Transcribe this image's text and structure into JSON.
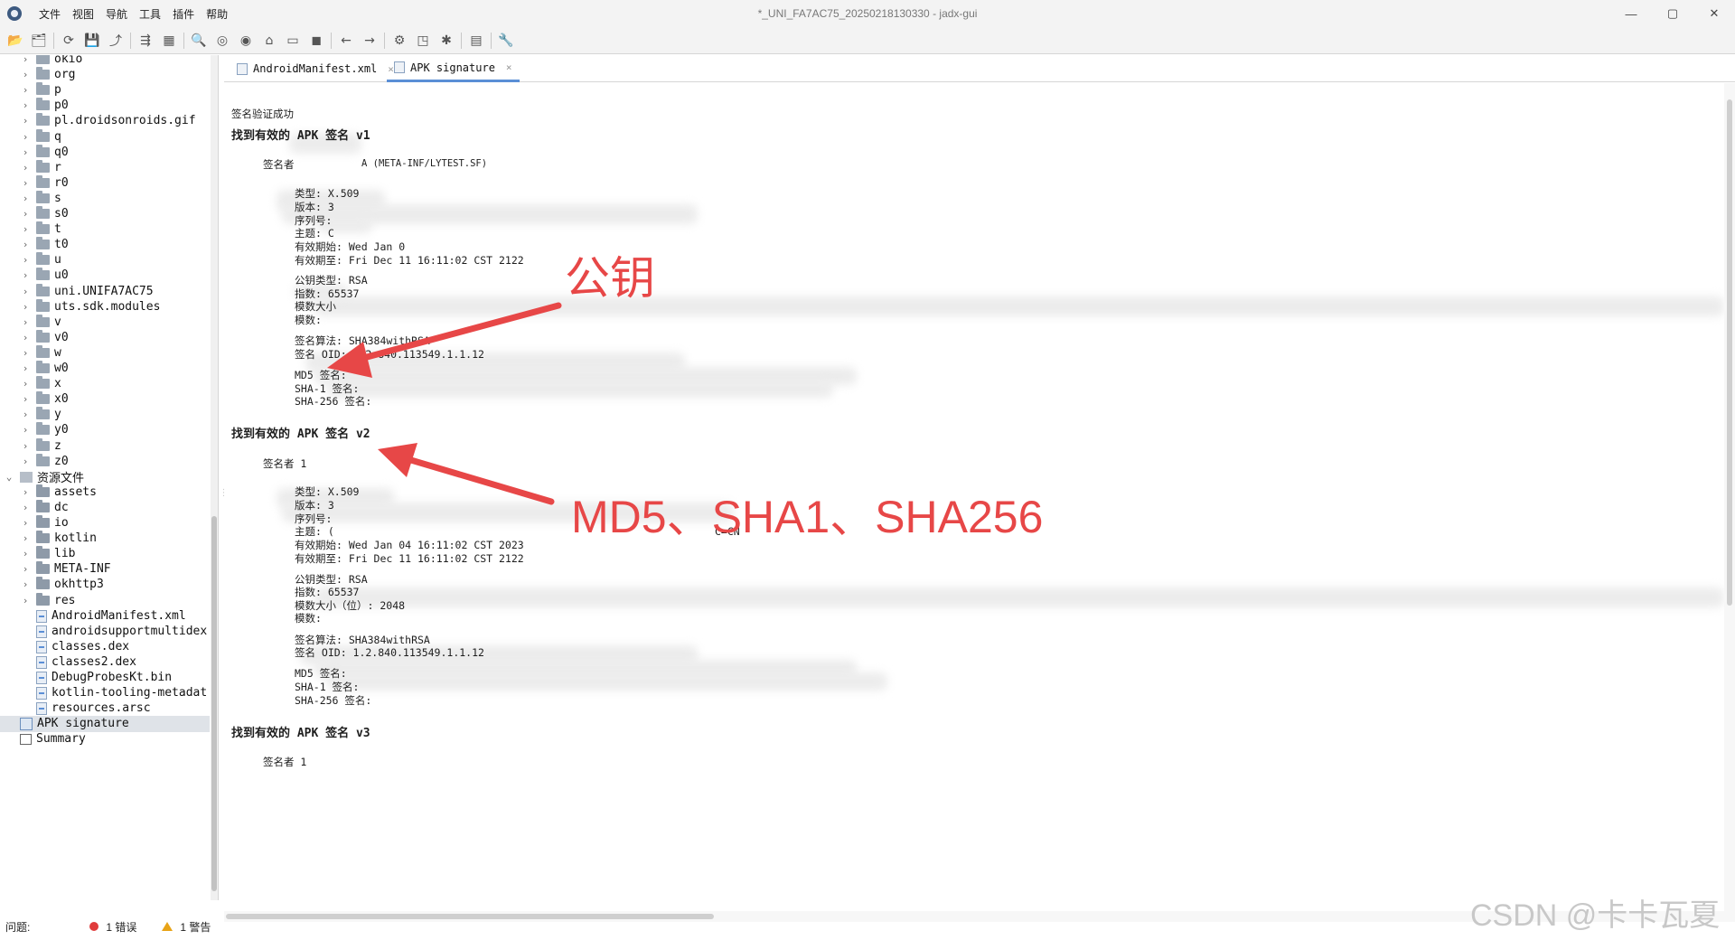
{
  "window": {
    "title": "*_UNI_FA7AC75_20250218130330 - jadx-gui",
    "controls": [
      "—",
      "▢",
      "✕"
    ]
  },
  "menu": [
    "文件",
    "视图",
    "导航",
    "工具",
    "插件",
    "帮助"
  ],
  "toolbar_icons": [
    "open-file-icon",
    "add-files-icon",
    "sync-icon",
    "save-icon",
    "export-icon",
    "flatten-icon",
    "deobf-icon",
    "search-icon",
    "find-class-icon",
    "find-usage-icon",
    "home-icon",
    "log-icon",
    "mark-icon",
    "back-icon",
    "forward-icon",
    "quark-icon",
    "frida-icon",
    "debug-icon",
    "log-viewer-icon",
    "settings-icon"
  ],
  "tree": {
    "items": [
      {
        "label": "okio",
        "icon": "package"
      },
      {
        "label": "org",
        "icon": "package"
      },
      {
        "label": "p",
        "icon": "package"
      },
      {
        "label": "p0",
        "icon": "package"
      },
      {
        "label": "pl.droidsonroids.gif",
        "icon": "package"
      },
      {
        "label": "q",
        "icon": "package"
      },
      {
        "label": "q0",
        "icon": "package"
      },
      {
        "label": "r",
        "icon": "package"
      },
      {
        "label": "r0",
        "icon": "package"
      },
      {
        "label": "s",
        "icon": "package"
      },
      {
        "label": "s0",
        "icon": "package"
      },
      {
        "label": "t",
        "icon": "package"
      },
      {
        "label": "t0",
        "icon": "package"
      },
      {
        "label": "u",
        "icon": "package"
      },
      {
        "label": "u0",
        "icon": "package"
      },
      {
        "label": "uni.UNIFA7AC75",
        "icon": "package"
      },
      {
        "label": "uts.sdk.modules",
        "icon": "package"
      },
      {
        "label": "v",
        "icon": "package"
      },
      {
        "label": "v0",
        "icon": "package"
      },
      {
        "label": "w",
        "icon": "package"
      },
      {
        "label": "w0",
        "icon": "package"
      },
      {
        "label": "x",
        "icon": "package"
      },
      {
        "label": "x0",
        "icon": "package"
      },
      {
        "label": "y",
        "icon": "package"
      },
      {
        "label": "y0",
        "icon": "package"
      },
      {
        "label": "z",
        "icon": "package"
      },
      {
        "label": "z0",
        "icon": "package"
      },
      {
        "label": "资源文件",
        "icon": "resources"
      },
      {
        "label": "assets",
        "icon": "folder"
      },
      {
        "label": "dc",
        "icon": "folder"
      },
      {
        "label": "io",
        "icon": "folder"
      },
      {
        "label": "kotlin",
        "icon": "folder"
      },
      {
        "label": "lib",
        "icon": "folder"
      },
      {
        "label": "META-INF",
        "icon": "folder"
      },
      {
        "label": "okhttp3",
        "icon": "folder"
      },
      {
        "label": "res",
        "icon": "folder"
      },
      {
        "label": "AndroidManifest.xml",
        "icon": "file"
      },
      {
        "label": "androidsupportmultidex",
        "icon": "file"
      },
      {
        "label": "classes.dex",
        "icon": "file"
      },
      {
        "label": "classes2.dex",
        "icon": "file"
      },
      {
        "label": "DebugProbesKt.bin",
        "icon": "file"
      },
      {
        "label": "kotlin-tooling-metadat",
        "icon": "file"
      },
      {
        "label": "resources.arsc",
        "icon": "file"
      },
      {
        "label": "APK signature",
        "icon": "signature"
      },
      {
        "label": "Summary",
        "icon": "summary"
      }
    ]
  },
  "status": {
    "label": "问题:",
    "errors": "1 错误",
    "warnings": "1 警告"
  },
  "tabs": [
    {
      "label": "AndroidManifest.xml",
      "close": "×"
    },
    {
      "label": "APK signature",
      "close": "×"
    }
  ],
  "signature": {
    "status": "签名验证成功",
    "v1": {
      "heading": "找到有效的 APK 签名 v1",
      "signer": "签名者",
      "signer_suffix": "A (META-INF/LYTEST.SF)",
      "type": "类型: X.509",
      "version": "版本: 3",
      "serial": "序列号:",
      "subject": "主题: C",
      "valid_from": "有效期始: Wed Jan 0",
      "valid_to": "有效期至: Fri Dec 11 16:11:02 CST 2122",
      "pubkey_type": "公钥类型: RSA",
      "exponent": "指数: 65537",
      "modulus_size": "模数大小",
      "modulus": "模数:",
      "sig_alg": "签名算法: SHA384withRSA",
      "sig_oid": "签名 OID: 1.2.840.113549.1.1.12",
      "md5": "MD5 签名:",
      "sha1": "SHA-1 签名:",
      "sha256": "SHA-256 签名:"
    },
    "v2": {
      "heading": "找到有效的 APK 签名 v2",
      "signer": "签名者 1",
      "type": "类型: X.509",
      "version": "版本: 3",
      "serial": "序列号:",
      "subject": "主题: (",
      "subject_suffix": "C=CN",
      "valid_from": "有效期始: Wed Jan 04 16:11:02 CST 2023",
      "valid_to": "有效期至: Fri Dec 11 16:11:02 CST 2122",
      "pubkey_type": "公钥类型: RSA",
      "exponent": "指数: 65537",
      "modulus_size": "模数大小（位）: 2048",
      "modulus": "模数:",
      "sig_alg": "签名算法: SHA384withRSA",
      "sig_oid": "签名 OID: 1.2.840.113549.1.1.12",
      "md5": "MD5 签名:",
      "sha1": "SHA-1 签名:",
      "sha256": "SHA-256 签名:"
    },
    "v3": {
      "heading": "找到有效的 APK 签名 v3",
      "signer": "签名者 1"
    }
  },
  "annotations": {
    "pubkey": "公钥",
    "hashes": "MD5、SHA1、SHA256",
    "color": "#e74747"
  },
  "watermark": "CSDN @卡卡瓦夏"
}
